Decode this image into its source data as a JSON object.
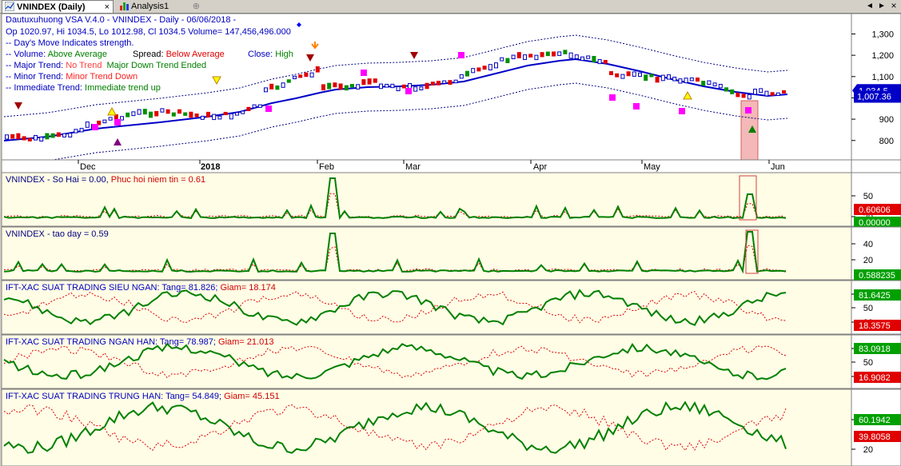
{
  "tabs": [
    {
      "label": "VNINDEX (Daily)",
      "active": true,
      "close": "×"
    },
    {
      "label": "Analysis1",
      "active": false,
      "add": "⊕"
    }
  ],
  "window_buttons": {
    "left": "◄",
    "right": "►",
    "close": "×"
  },
  "price_pane": {
    "title_line": "Dautuxuhuong VSA V.4.0 - VNINDEX - Daily  -  06/06/2018  -",
    "ohlc_line": "Op 1020.97, Hi 1034.5, Lo 1012.98, Cl 1034.5  Volume= 147,456,496.000",
    "info": [
      {
        "label": "-- Day's Move Indicates strength.",
        "value": ""
      },
      {
        "label": "-- Volume: ",
        "value": "Above Average"
      },
      {
        "label": "Spread: ",
        "value": "Below Average"
      },
      {
        "label": "Close: ",
        "value": "High"
      },
      {
        "label": "-- Major Trend: ",
        "value": "No Trend",
        "extra": "Major Down Trend Ended"
      },
      {
        "label": "-- Minor Trend: ",
        "value": "Minor Trend Down"
      },
      {
        "label": "-- Immediate Trend: ",
        "value": "Immediate trend up"
      }
    ],
    "axis_ticks": [
      "1,300",
      "1,200",
      "1,100",
      "1,000",
      "900",
      "800"
    ],
    "axis_tick_values": [
      1300,
      1200,
      1100,
      1000,
      900,
      800
    ],
    "price_tag": "1,034.5",
    "ma_tag": "1,007.36",
    "price_value": 1034.5,
    "ma_value": 1007.36,
    "date_labels": [
      "Dec",
      "2018",
      "Feb",
      "Mar",
      "Apr",
      "May",
      "Jun"
    ]
  },
  "panes": [
    {
      "name": "VNINDEX",
      "parts": [
        {
          "text": "VNINDEX - So Hai = 0.00, ",
          "color": "#000080"
        },
        {
          "text": "Phuc hoi niem tin = 0.61",
          "color": "#d00000"
        }
      ],
      "ticks": [
        "50",
        "20"
      ],
      "tags": [
        "0.60606",
        "0.00000"
      ]
    },
    {
      "name": "VNINDEX",
      "parts": [
        {
          "text": "VNINDEX - tao day  = 0.59",
          "color": "#000080"
        }
      ],
      "ticks": [
        "40",
        "20"
      ],
      "tags": [
        "0.588235"
      ]
    },
    {
      "name": "sieu-ngan",
      "parts": [
        {
          "text": "IFT-XAC SUAT TRADING SIEU NGAN: Tang=  81.826; ",
          "color": "#0000c0"
        },
        {
          "text": "Giam=  18.174",
          "color": "#d00000"
        }
      ],
      "ticks": [
        "80",
        "50",
        "20"
      ],
      "tags": [
        "81.6425",
        "18.3575"
      ]
    },
    {
      "name": "ngan-han",
      "parts": [
        {
          "text": "IFT-XAC SUAT TRADING NGAN HAN: Tang=  78.987; ",
          "color": "#0000c0"
        },
        {
          "text": "Giam=  21.013",
          "color": "#d00000"
        }
      ],
      "ticks": [
        "80",
        "50",
        "20"
      ],
      "tags": [
        "83.0918",
        "16.9082"
      ]
    },
    {
      "name": "trung-han",
      "parts": [
        {
          "text": "IFT-XAC SUAT TRADING TRUNG HAN: Tang=  54.849; ",
          "color": "#0000c0"
        },
        {
          "text": "Giam=  45.151",
          "color": "#d00000"
        }
      ],
      "ticks": [
        "50",
        "20"
      ],
      "tags": [
        "60.1942",
        "39.8058"
      ]
    }
  ],
  "colors": {
    "up": "#008000",
    "down": "#e00000",
    "ma": "#0000c8",
    "price_bg": "#ffffff",
    "osc_bg": "#fffde6",
    "highlight": "#f4b8b8"
  }
}
